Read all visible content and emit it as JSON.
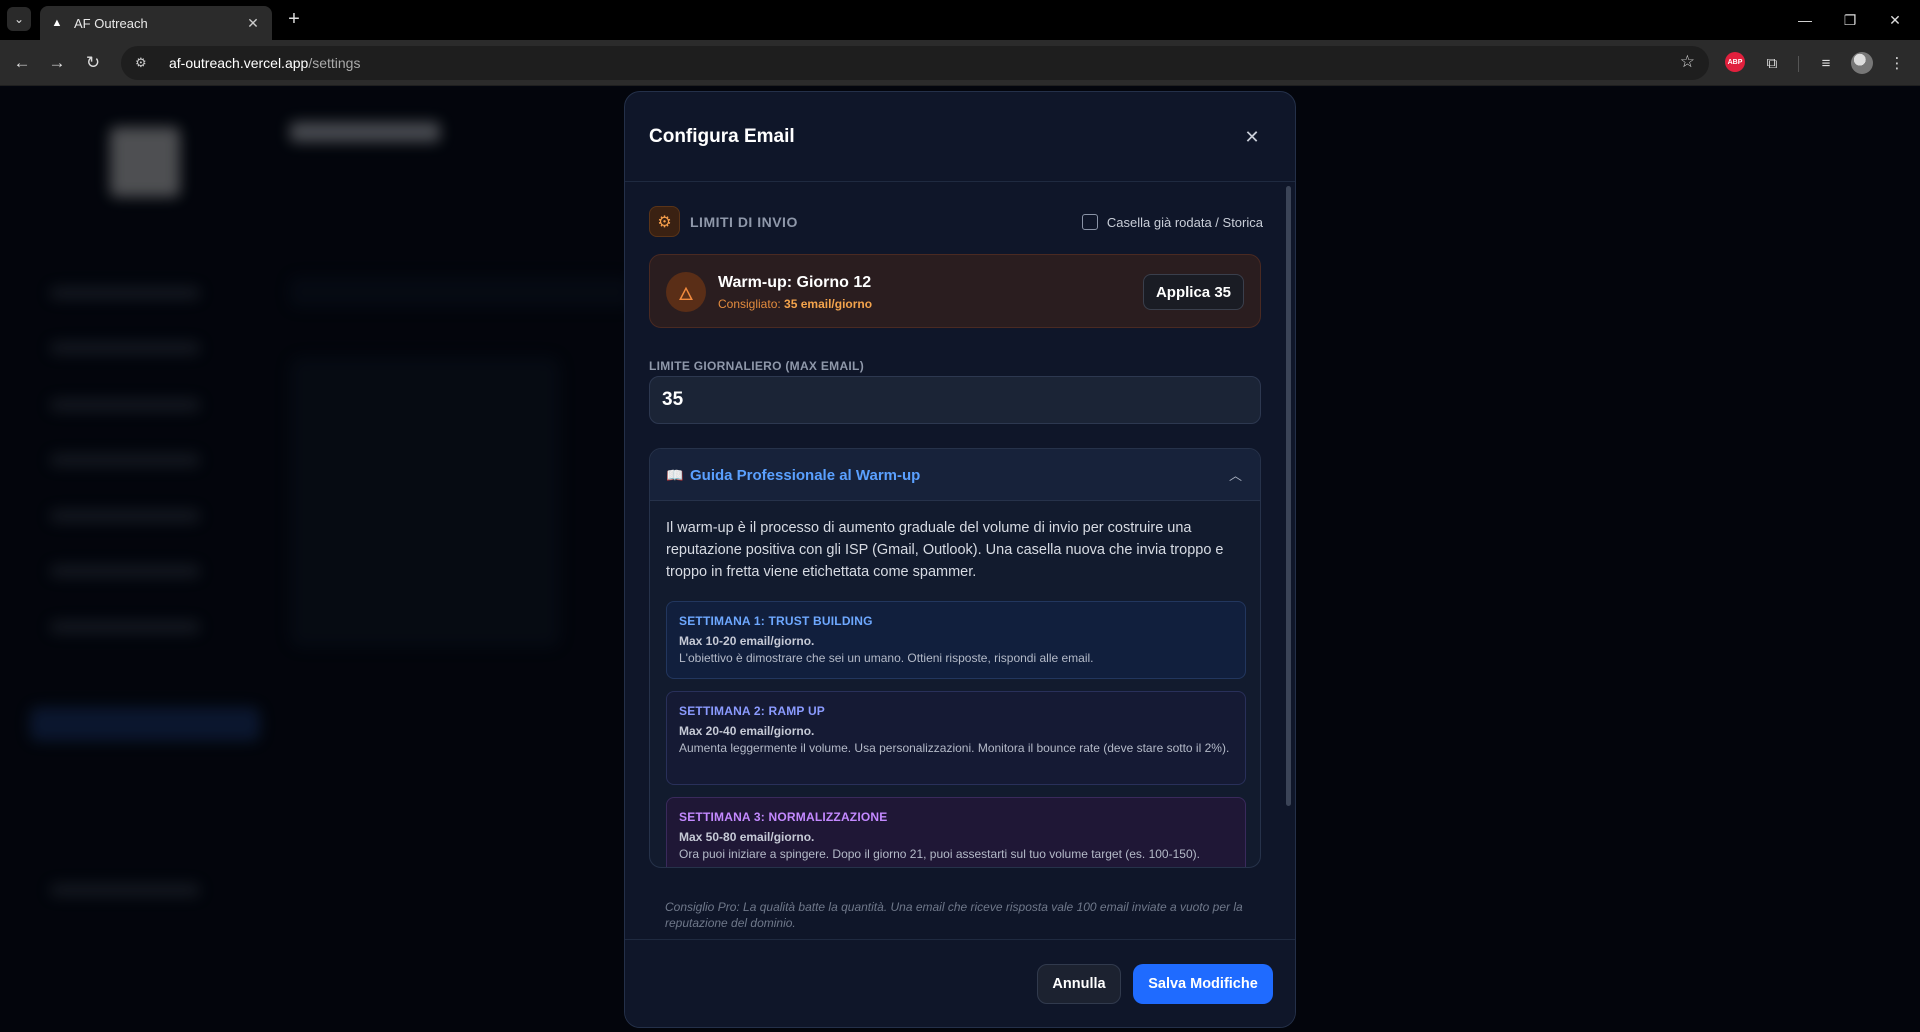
{
  "browser": {
    "tab_title": "AF Outreach",
    "url_host": "af-outreach.vercel.app",
    "url_path": "/settings",
    "icons": [
      "tab-search-icon",
      "tab-favicon",
      "close-icon",
      "plus-icon",
      "back-icon",
      "forward-icon",
      "reload-icon",
      "site-info-icon",
      "star-icon",
      "adblock-icon",
      "extensions-icon",
      "media-icon",
      "profile-avatar",
      "menu-icon"
    ],
    "abp_label": "ABP"
  },
  "modal": {
    "title": "Configura Email",
    "section_label": "LIMITI DI INVIO",
    "checkbox_label": "Casella già rodata / Storica",
    "checkbox_checked": false,
    "warmup": {
      "title": "Warm-up: Giorno 12",
      "sub_prefix": "Consigliato:",
      "sub_value": "35 email/giorno",
      "apply_label": "Applica 35"
    },
    "daily_limit": {
      "label": "LIMITE GIORNALIERO (MAX EMAIL)",
      "value": "35"
    },
    "guide": {
      "title": "Guida Professionale al Warm-up",
      "expanded": true,
      "intro": "Il warm-up è il processo di aumento graduale del volume di invio per costruire una reputazione positiva con gli ISP (Gmail, Outlook). Una casella nuova che invia troppo e troppo in fretta viene etichettata come spammer.",
      "weeks": [
        {
          "title": "SETTIMANA 1: TRUST BUILDING",
          "max": "Max 10-20 email/giorno.",
          "desc": "L'obiettivo è dimostrare che sei un umano. Ottieni risposte, rispondi alle email."
        },
        {
          "title": "SETTIMANA 2: RAMP UP",
          "max": "Max 20-40 email/giorno.",
          "desc": "Aumenta leggermente il volume. Usa personalizzazioni. Monitora il bounce rate (deve stare sotto il 2%)."
        },
        {
          "title": "SETTIMANA 3: NORMALIZZAZIONE",
          "max": "Max 50-80 email/giorno.",
          "desc": "Ora puoi iniziare a spingere. Dopo il giorno 21, puoi assestarti sul tuo volume target (es. 100-150)."
        }
      ],
      "pro_tip": "Consiglio Pro: La qualità batte la quantità. Una email che riceve risposta vale 100 email inviate a vuoto per la reputazione del dominio."
    },
    "footer": {
      "cancel_label": "Annulla",
      "save_label": "Salva Modifiche"
    }
  },
  "colors": {
    "accent_blue": "#1f6bff",
    "warmup_orange": "#f08a3e",
    "modal_bg": "#0f1629"
  }
}
